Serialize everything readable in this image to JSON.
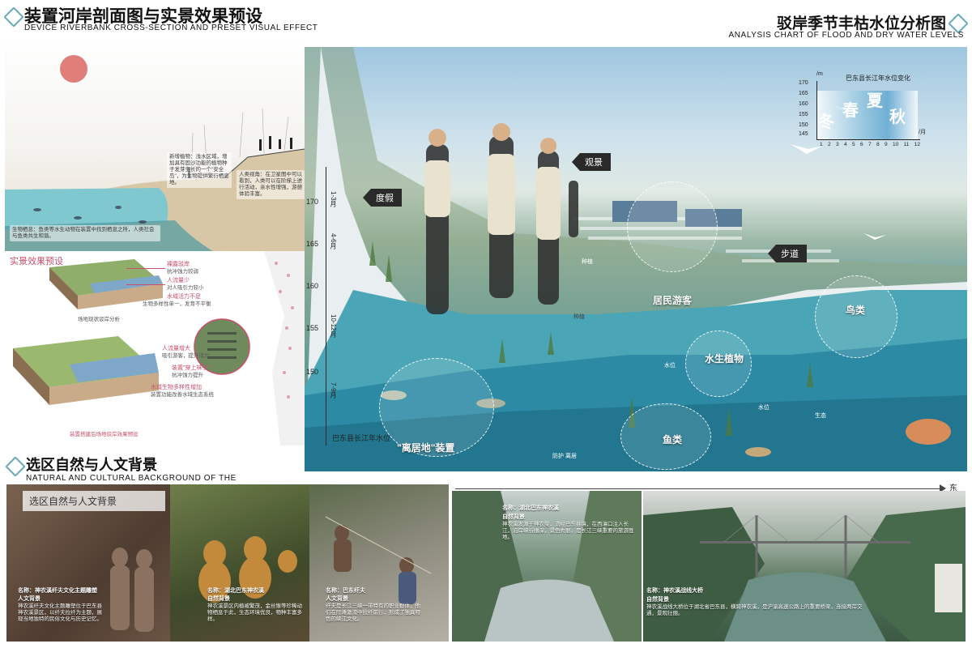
{
  "header_left": {
    "title_cn": "装置河岸剖面图与实景效果预设",
    "title_en": "DEVICE RIVERBANK CROSS-SECTION AND PRESET VISUAL EFFECT"
  },
  "header_right": {
    "title_cn": "驳岸季节丰枯水位分析图",
    "title_en": "ANALYSIS CHART OF FLOOD AND DRY WATER LEVELS"
  },
  "section": {
    "notes": [
      "新增植物：浅水区域，增加具有固沙功能的植物种子发芽生长的一个\"安全岛\"，为生物提供繁衍栖息地。",
      "人类视角：在卫星图中可以看到，人类可以在阶梯上进行活动，亲水性增强，游憩体验丰富。",
      "生物栖息：鱼类等水生动物在装置中找到栖息之所，人类社会与鱼类共生和谐。"
    ]
  },
  "preset": {
    "label": "实景效果预设",
    "top_labels": [
      {
        "title": "裸露驳岸",
        "sub": "抗冲蚀力较弱"
      },
      {
        "title": "人流量少",
        "sub": "对人吸引力较小"
      },
      {
        "title": "水域活力不足",
        "sub": "生物多样性单一，发育不平衡"
      }
    ],
    "top_caption": "场地现状驳岸分析",
    "bottom_labels": [
      {
        "title": "人流量增大",
        "sub": "吸引游客，提升活力"
      },
      {
        "title": "装置\"穿上袜子\"",
        "sub": "抗冲蚀力提升"
      },
      {
        "title": "水域生物多样性增加",
        "sub": "装置功能改善水域生态系统"
      }
    ],
    "bottom_caption": "装置搭建后场地驳岸效果预设"
  },
  "main": {
    "tags": {
      "vacation": "度假",
      "viewing": "观景",
      "walkway": "步道"
    },
    "circles": {
      "residents": "居民游客",
      "birds": "鸟类",
      "aquatic": "水生植物",
      "fish": "鱼类",
      "habitat": "\"离居地\"装置"
    },
    "small_labels": [
      "种植",
      "种植",
      "水位",
      "水位",
      "生态",
      "防护 离居"
    ],
    "axis": {
      "ticks": [
        "170",
        "165",
        "160",
        "155",
        "150"
      ],
      "months": [
        "1-3月",
        "4-6月",
        "10-12月",
        "7-9月"
      ],
      "caption": "巴东县长江年水位"
    },
    "inset": {
      "title": "巴东县长江年水位变化",
      "y_unit": "/m",
      "x_unit": "/月",
      "y_ticks": [
        "170",
        "165",
        "160",
        "155",
        "150",
        "145"
      ],
      "x_ticks": [
        "1",
        "2",
        "3",
        "4",
        "5",
        "6",
        "7",
        "8",
        "9",
        "10",
        "11",
        "12"
      ],
      "seasons": [
        "冬",
        "春",
        "夏",
        "秋"
      ]
    }
  },
  "bottom": {
    "title_cn": "选区自然与人文背景",
    "title_en": "NATURAL AND CULTURAL BACKGROUND OF THE",
    "box_label": "选区自然与人文背景",
    "photos": [
      {
        "title": "名称：神农溪纤夫文化主题雕塑",
        "sub": "人文背景",
        "text": "神农溪纤夫文化主题雕塑位于巴东县神农溪景区，以纤夫拉纤为主题，展现当地独特的民俗文化与历史记忆。"
      },
      {
        "title": "名称：湖北巴东神农溪",
        "sub": "自然背景",
        "text": "神农溪景区内植被繁茂，金丝猴等珍稀动物栖息于此，生态环境优良，物种丰富多样。"
      },
      {
        "title": "名称：巴东纤夫",
        "sub": "人文背景",
        "text": "纤夫是长江三峡一带特有的职业群体，他们在险滩激流中拉纤前行，形成了独具特色的峡江文化。"
      },
      {
        "title": "名称：湖北巴东神农溪",
        "sub": "自然背景",
        "text": "神农溪发源于神农架，流经巴东县境，在西瀼口注入长江，沿岸峡谷幽深，景色秀丽，是长江三峡重要的旅游胜地。"
      },
      {
        "title": "名称：神农溪战线大桥",
        "sub": "自然背景",
        "text": "神农溪战线大桥位于湖北省巴东县，横跨神农溪，是沪渝高速公路上的重要桥梁，连接两岸交通，景观壮丽。"
      }
    ],
    "arrow_label": "东"
  }
}
